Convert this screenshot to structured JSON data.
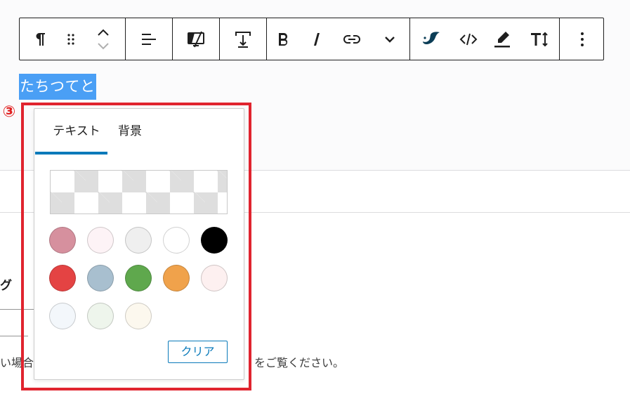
{
  "toolbar": {
    "buttons": [
      {
        "icon": "paragraph-icon"
      },
      {
        "icon": "drag-handle-icon"
      },
      {
        "icon": "move-up-down-icon"
      },
      {
        "icon": "align-left-icon"
      },
      {
        "icon": "hide-on-device-icon"
      },
      {
        "icon": "spacing-icon"
      },
      {
        "icon": "bold-icon"
      },
      {
        "icon": "italic-icon"
      },
      {
        "icon": "link-icon"
      },
      {
        "icon": "more-formats-chevron-icon"
      },
      {
        "icon": "plugin-bird-icon"
      },
      {
        "icon": "code-icon"
      },
      {
        "icon": "highlight-icon"
      },
      {
        "icon": "text-size-icon"
      },
      {
        "icon": "kebab-menu-icon"
      }
    ]
  },
  "selected_text": "たちつてと",
  "step_badge": "③",
  "color_popover": {
    "tabs": [
      {
        "label": "テキスト",
        "active": true
      },
      {
        "label": "背景",
        "active": false
      }
    ],
    "swatches": [
      "#d6909e",
      "#fdf3f6",
      "#efefef",
      "#ffffff",
      "#000000",
      "#e44343",
      "#a8bfcf",
      "#5fa84d",
      "#f0a24b",
      "#fdf0f0",
      "#f3f7fb",
      "#eef5ec",
      "#fcf8ee"
    ],
    "clear_label": "クリア"
  },
  "background": {
    "heading_fragment": "グ",
    "help_left_fragment": "い場合",
    "help_right_fragment": "をご覧ください。"
  },
  "colors": {
    "accent": "#0a7aba",
    "annotation_red": "#e0242f",
    "selection": "#4a9ff5"
  }
}
